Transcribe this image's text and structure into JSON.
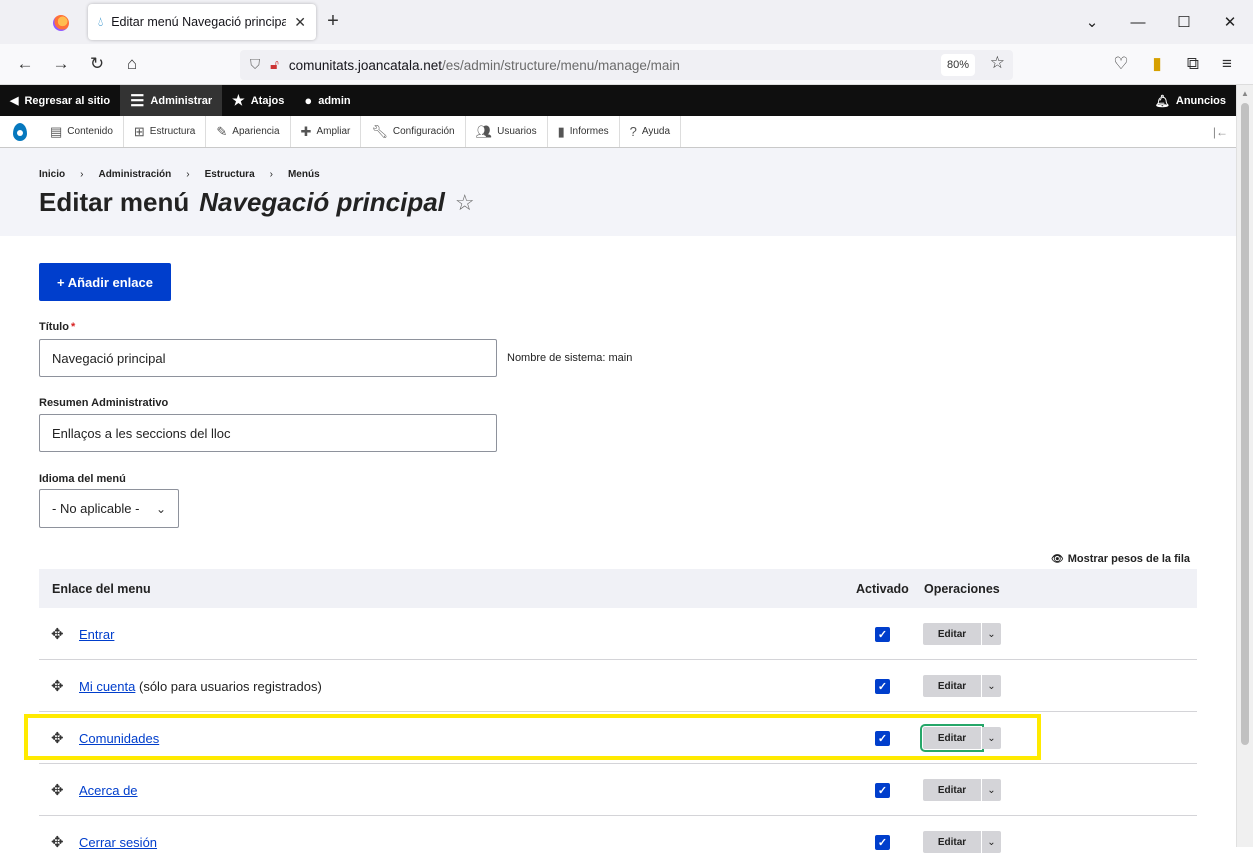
{
  "browser": {
    "tab_title": "Editar menú Navegació principal",
    "url_host": "comunitats.joancatala.net",
    "url_path": "/es/admin/structure/menu/manage/main",
    "zoom": "80%"
  },
  "toolbar": {
    "back_site": "Regresar al sitio",
    "manage": "Administrar",
    "shortcuts": "Atajos",
    "user": "admin",
    "announcements": "Anuncios"
  },
  "tray": [
    "Contenido",
    "Estructura",
    "Apariencia",
    "Ampliar",
    "Configuración",
    "Usuarios",
    "Informes",
    "Ayuda"
  ],
  "breadcrumb": [
    "Inicio",
    "Administración",
    "Estructura",
    "Menús"
  ],
  "page": {
    "title_prefix": "Editar menú",
    "title_name": "Navegació principal"
  },
  "form": {
    "add_link": "+ Añadir enlace",
    "title_label": "Título",
    "title_value": "Navegació principal",
    "machine_name": "Nombre de sistema: main",
    "summary_label": "Resumen Administrativo",
    "summary_value": "Enllaços a les seccions del lloc",
    "language_label": "Idioma del menú",
    "language_value": "- No aplicable -"
  },
  "table": {
    "show_weights": "Mostrar pesos de la fila",
    "headers": {
      "link": "Enlace del menu",
      "enabled": "Activado",
      "operations": "Operaciones"
    },
    "rows": [
      {
        "label": "Entrar",
        "note": "",
        "edit": "Editar"
      },
      {
        "label": "Mi cuenta",
        "note": "(sólo para usuarios registrados)",
        "edit": "Editar"
      },
      {
        "label": "Comunidades",
        "note": "",
        "edit": "Editar"
      },
      {
        "label": "Acerca de",
        "note": "",
        "edit": "Editar"
      },
      {
        "label": "Cerrar sesión",
        "note": "",
        "edit": "Editar"
      }
    ]
  },
  "colors": {
    "primary": "#003ecc",
    "highlight": "#ffea00",
    "focus": "#26a769"
  }
}
